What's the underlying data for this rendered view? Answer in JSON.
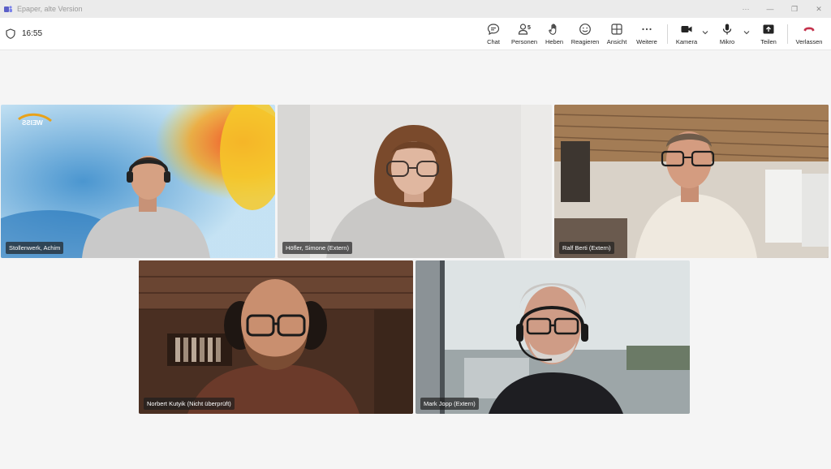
{
  "window": {
    "title": "Epaper, alte Version",
    "controls": {
      "more": "···",
      "minimize": "—",
      "restore": "❐",
      "close": "✕"
    }
  },
  "toolbar": {
    "timer": "16:55",
    "participant_count": "5",
    "buttons": {
      "chat": "Chat",
      "people": "Personen",
      "raise": "Heben",
      "react": "Reagieren",
      "view": "Ansicht",
      "more": "Weitere",
      "camera": "Kamera",
      "mic": "Mikro",
      "share": "Teilen",
      "leave": "Verlassen"
    }
  },
  "participants": [
    {
      "name": "Stollenwerk, Achim"
    },
    {
      "name": "Höfler, Simone (Extern)"
    },
    {
      "name": "Ralf Berti (Extern)"
    },
    {
      "name": "Norbert Kutyik (Nicht überprüft)"
    },
    {
      "name": "Mark Jopp (Extern)"
    }
  ],
  "background_logo": "WEISS",
  "colors": {
    "accent": "#5b5fc7",
    "leave": "#c4314b"
  }
}
